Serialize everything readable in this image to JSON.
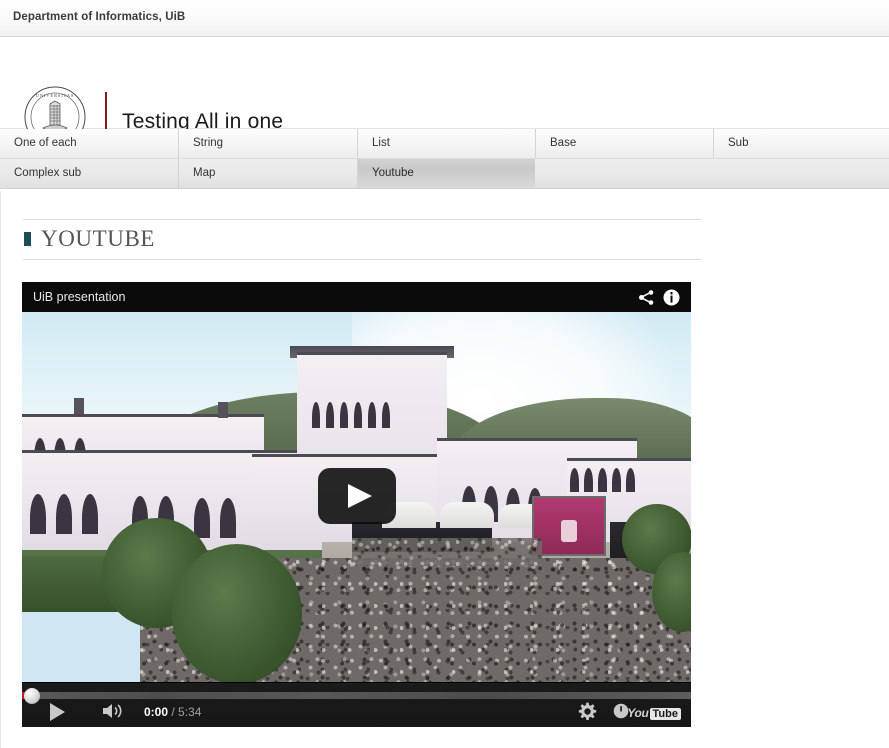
{
  "topbar": {
    "department": "Department of Informatics, UiB"
  },
  "header": {
    "logo_alt": "uib-seal-logo",
    "site_title": "Testing All in one"
  },
  "tabs": {
    "row1": [
      {
        "label": "One of each",
        "active": false
      },
      {
        "label": "String",
        "active": false
      },
      {
        "label": "List",
        "active": false
      },
      {
        "label": "Base",
        "active": false
      },
      {
        "label": "Sub",
        "active": false
      }
    ],
    "row2": [
      {
        "label": "Complex sub",
        "active": false
      },
      {
        "label": "Map",
        "active": false
      },
      {
        "label": "Youtube",
        "active": true
      }
    ]
  },
  "section": {
    "title": "YOUTUBE",
    "bullet_color": "#1d4d57"
  },
  "player": {
    "video_title": "UiB presentation",
    "share_icon": "share-icon",
    "info_icon": "info-icon",
    "play_overlay_icon": "play-icon",
    "controls": {
      "play_label": "play-icon",
      "volume_label": "volume-icon",
      "current_time": "0:00",
      "time_separator": " / ",
      "total_time": "5:34",
      "settings_icon": "gear-icon",
      "watch_later_icon": "watch-later-icon",
      "logo_you": "You",
      "logo_tube": "Tube"
    }
  }
}
